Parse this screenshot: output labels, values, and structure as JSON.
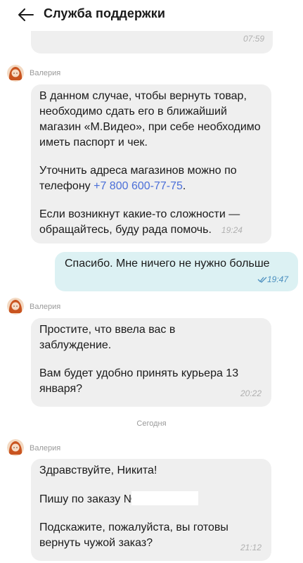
{
  "header": {
    "title": "Служба поддержки",
    "back_icon": "arrow-left-icon"
  },
  "messages": [
    {
      "time": "07:59"
    },
    {
      "sender": "Валерия",
      "paragraphs": [
        "В данном случае, чтобы вернуть товар, необходимо сдать его в ближайший магазин «М.Видео», при себе необходимо иметь паспорт и чек.",
        "Уточнить адреса магазинов можно по телефону",
        "Если возникнут какие-то сложности — обращайтесь, буду рада помочь."
      ],
      "phone": "+7 800 600-77-75",
      "phone_suffix": ".",
      "time": "19:24"
    },
    {
      "outgoing": true,
      "text": "Спасибо. Мне ничего не нужно больше",
      "status_icon": "double-check-icon",
      "time": "19:47"
    },
    {
      "sender": "Валерия",
      "paragraphs": [
        "Простите, что ввела вас в заблуждение.",
        "Вам будет удобно принять курьера 13 января?"
      ],
      "time": "20:22"
    },
    {
      "date_separator": "Сегодня"
    },
    {
      "sender": "Валерия",
      "paragraphs": [
        "Здравствуйте, Никита!",
        "Пишу по заказу №",
        "Подскажите, пожалуйста, вы готовы вернуть чужой заказ?"
      ],
      "time": "21:12"
    }
  ],
  "colors": {
    "incoming_bubble": "#efefef",
    "outgoing_bubble": "#dcf1f3",
    "link": "#4b6fd8",
    "timestamp": "#b0b0b0",
    "outgoing_timestamp": "#4b8fbf"
  }
}
